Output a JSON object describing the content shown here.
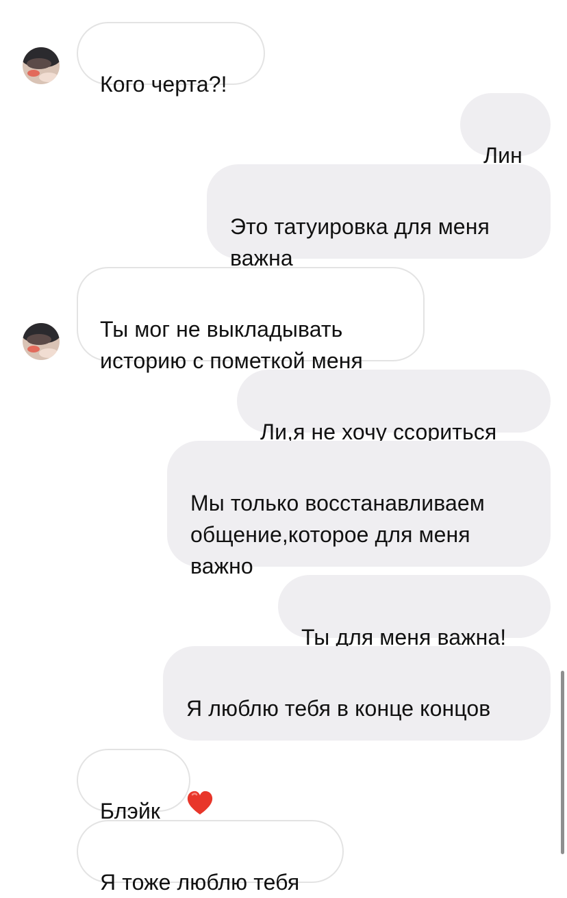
{
  "conversation": {
    "messages": [
      {
        "direction": "incoming",
        "text": "Кого черта?!"
      },
      {
        "direction": "outgoing",
        "text": "Лин"
      },
      {
        "direction": "outgoing",
        "text": "Это татуировка для меня\nважна"
      },
      {
        "direction": "incoming",
        "text": "Ты мог не выкладывать\nисторию с пометкой меня"
      },
      {
        "direction": "outgoing",
        "text": "Ли,я не хочу ссориться"
      },
      {
        "direction": "outgoing",
        "text": "Мы только восстанавливаем\nобщение,которое для меня\nважно"
      },
      {
        "direction": "outgoing",
        "text": "Ты для меня важна!"
      },
      {
        "direction": "outgoing",
        "text": "Я люблю тебя в конце концов",
        "emoji": "red-heart"
      },
      {
        "direction": "incoming",
        "text": "Блэйк"
      },
      {
        "direction": "incoming",
        "text": "Я тоже люблю тебя"
      }
    ]
  },
  "colors": {
    "outgoing_bubble": "#efeef1",
    "incoming_border": "#e3e3e3",
    "heart": "#e8362a"
  }
}
